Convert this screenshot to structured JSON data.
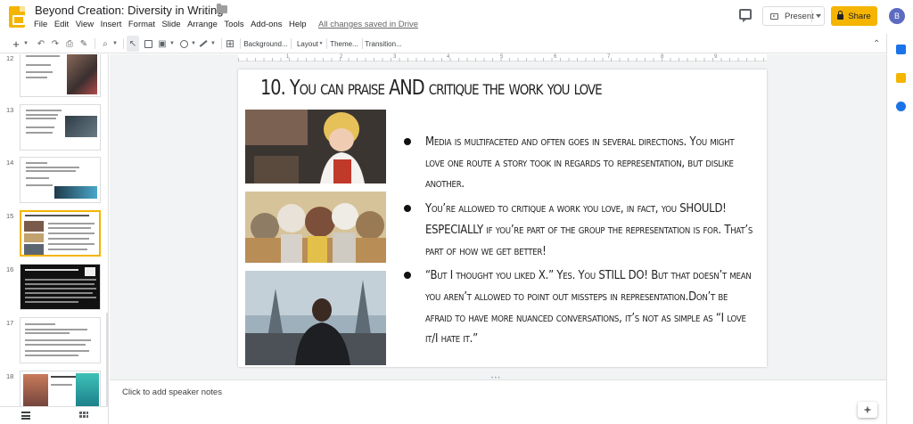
{
  "document": {
    "title": "Beyond Creation: Diversity in Writing",
    "save_status": "All changes saved in Drive"
  },
  "menu": [
    "File",
    "Edit",
    "View",
    "Insert",
    "Format",
    "Slide",
    "Arrange",
    "Tools",
    "Add-ons",
    "Help"
  ],
  "header": {
    "present_label": "Present",
    "share_label": "Share",
    "avatar_initial": "B"
  },
  "toolbar": {
    "new_slide": "+",
    "background": "Background...",
    "layout": "Layout",
    "theme": "Theme...",
    "transition": "Transition..."
  },
  "ruler": {
    "marks": [
      "1",
      "2",
      "3",
      "4",
      "5",
      "6",
      "7",
      "8",
      "9"
    ]
  },
  "filmstrip": {
    "slides": [
      {
        "number": "12"
      },
      {
        "number": "13"
      },
      {
        "number": "14"
      },
      {
        "number": "15"
      },
      {
        "number": "16"
      },
      {
        "number": "17"
      },
      {
        "number": "18"
      }
    ]
  },
  "slide": {
    "title": "10. You can praise AND critique the work you love",
    "bullets": [
      "Media is multifaceted and often goes in several directions. You might love one route a story took in regards to representation, but dislike another.",
      "You’re allowed to critique a work you love, in fact, you SHOULD! ESPECIALLY if you’re part of the group the representation is for. That’s part of how we get better!",
      "“But I thought you liked X.” Yes. You STILL DO! But that doesn’t mean you aren’t allowed to point out missteps in representation.Don’t be afraid to have more nuanced conversations, it’s not as simple as “I love it/I hate it.”"
    ]
  },
  "notes": {
    "placeholder": "Click to add speaker notes"
  },
  "colors": {
    "accent": "#f4b400",
    "canvas_bg": "#f1f3f4"
  }
}
